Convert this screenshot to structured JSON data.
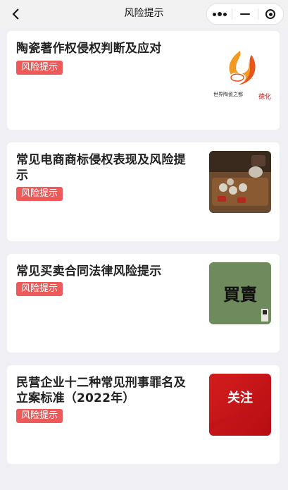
{
  "nav": {
    "title": "风险提示",
    "back_icon": "chevron-left-icon",
    "more_icon": "more-dots-icon",
    "minimize_icon": "minimize-icon",
    "close_icon": "target-circle-icon"
  },
  "articles": [
    {
      "title": "陶瓷著作权侵权判断及应对",
      "tag": "风险提示",
      "thumbnail": "porcelain-city-logo",
      "thumb_text": "世界陶瓷之都",
      "thumb_seal": "德化"
    },
    {
      "title": "常见电商商标侵权表现及风险提示",
      "tag": "风险提示",
      "thumbnail": "tea-set-photo"
    },
    {
      "title": "常见买卖合同法律风险提示",
      "tag": "风险提示",
      "thumbnail": "calligraphy-maimai",
      "thumb_text": "買賣"
    },
    {
      "title": "民营企业十二种常见刑事罪名及立案标准（2022年）",
      "tag": "风险提示",
      "thumbnail": "guanzhu-red-banner",
      "thumb_text": "关注"
    }
  ],
  "colors": {
    "tag_bg": "#ec5b59",
    "page_bg": "#efeff4",
    "card_bg": "#ffffff"
  }
}
